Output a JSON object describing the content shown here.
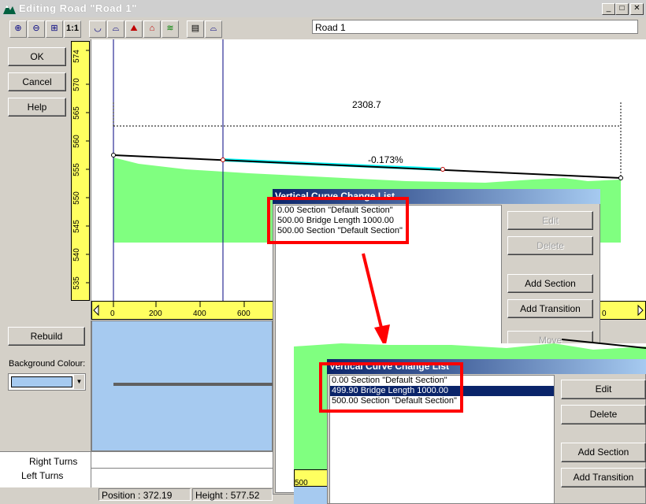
{
  "window": {
    "title": "Editing Road \"Road 1\"",
    "controls": [
      "_",
      "□",
      "✕"
    ]
  },
  "toolbar": {
    "road_name_value": "Road 1"
  },
  "actions": {
    "ok_label": "OK",
    "cancel_label": "Cancel",
    "help_label": "Help"
  },
  "vertical_ruler": {
    "ticks": [
      "574",
      "570",
      "565",
      "560",
      "555",
      "550",
      "545",
      "540",
      "535"
    ]
  },
  "horizontal_ruler": {
    "ticks": [
      "0",
      "200",
      "400",
      "600"
    ],
    "end_tick": "0"
  },
  "profile": {
    "length_label": "2308.7",
    "grade_label": "-0.173%"
  },
  "lower_panel": {
    "rebuild_label": "Rebuild",
    "background_colour_label": "Background Colour:",
    "background_colour": "#a6caf0"
  },
  "turns": {
    "right_label": "Right Turns",
    "left_label": "Left Turns"
  },
  "status": {
    "position": "Position : 372.19",
    "height": "Height : 577.52"
  },
  "dialog_before": {
    "title": "Vertical Curve Change List",
    "items": [
      "0.00 Section \"Default Section\"",
      "500.00 Bridge Length 1000.00",
      "500.00 Section \"Default Section\""
    ],
    "buttons": {
      "edit": "Edit",
      "delete": "Delete",
      "add_section": "Add Section",
      "add_transition": "Add Transition",
      "move": "Move"
    }
  },
  "dialog_after": {
    "title": "Vertical Curve Change List",
    "items": [
      "0.00 Section \"Default Section\"",
      "499.90 Bridge Length 1000.00",
      "500.00 Section \"Default Section\""
    ],
    "buttons": {
      "edit": "Edit",
      "delete": "Delete",
      "add_section": "Add Section",
      "add_transition": "Add Transition"
    },
    "ruler_tick": "500"
  },
  "colors": {
    "terrain": "#80ff80",
    "highlight": "#00ffff",
    "annotation": "#ff0000"
  }
}
